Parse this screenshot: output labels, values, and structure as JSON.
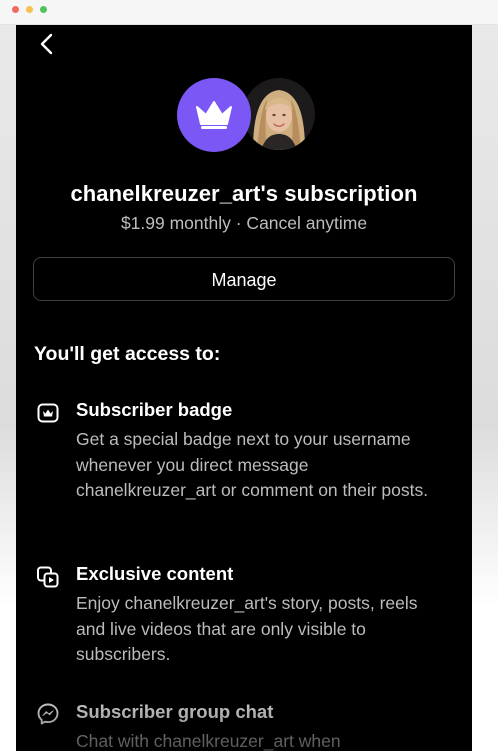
{
  "window": {
    "controls": [
      "close",
      "minimize",
      "zoom"
    ]
  },
  "header": {
    "back_icon": "chevron-left-icon"
  },
  "subscription": {
    "badge_icon": "crown-icon",
    "badge_color": "#7b58f6",
    "title": "chanelkreuzer_art's subscription",
    "price": "$1.99 monthly · Cancel anytime",
    "manage_label": "Manage"
  },
  "access": {
    "heading": "You'll get access to:",
    "features": [
      {
        "icon": "badge-icon",
        "title": "Subscriber badge",
        "description": "Get a special badge next to your username whenever you direct message chanelkreuzer_art or comment on their posts."
      },
      {
        "icon": "media-icon",
        "title": "Exclusive content",
        "description": "Enjoy chanelkreuzer_art's story, posts, reels and live videos that are only visible to subscribers."
      },
      {
        "icon": "messenger-icon",
        "title": "Subscriber group chat",
        "description": "Chat with chanelkreuzer_art when"
      }
    ]
  }
}
